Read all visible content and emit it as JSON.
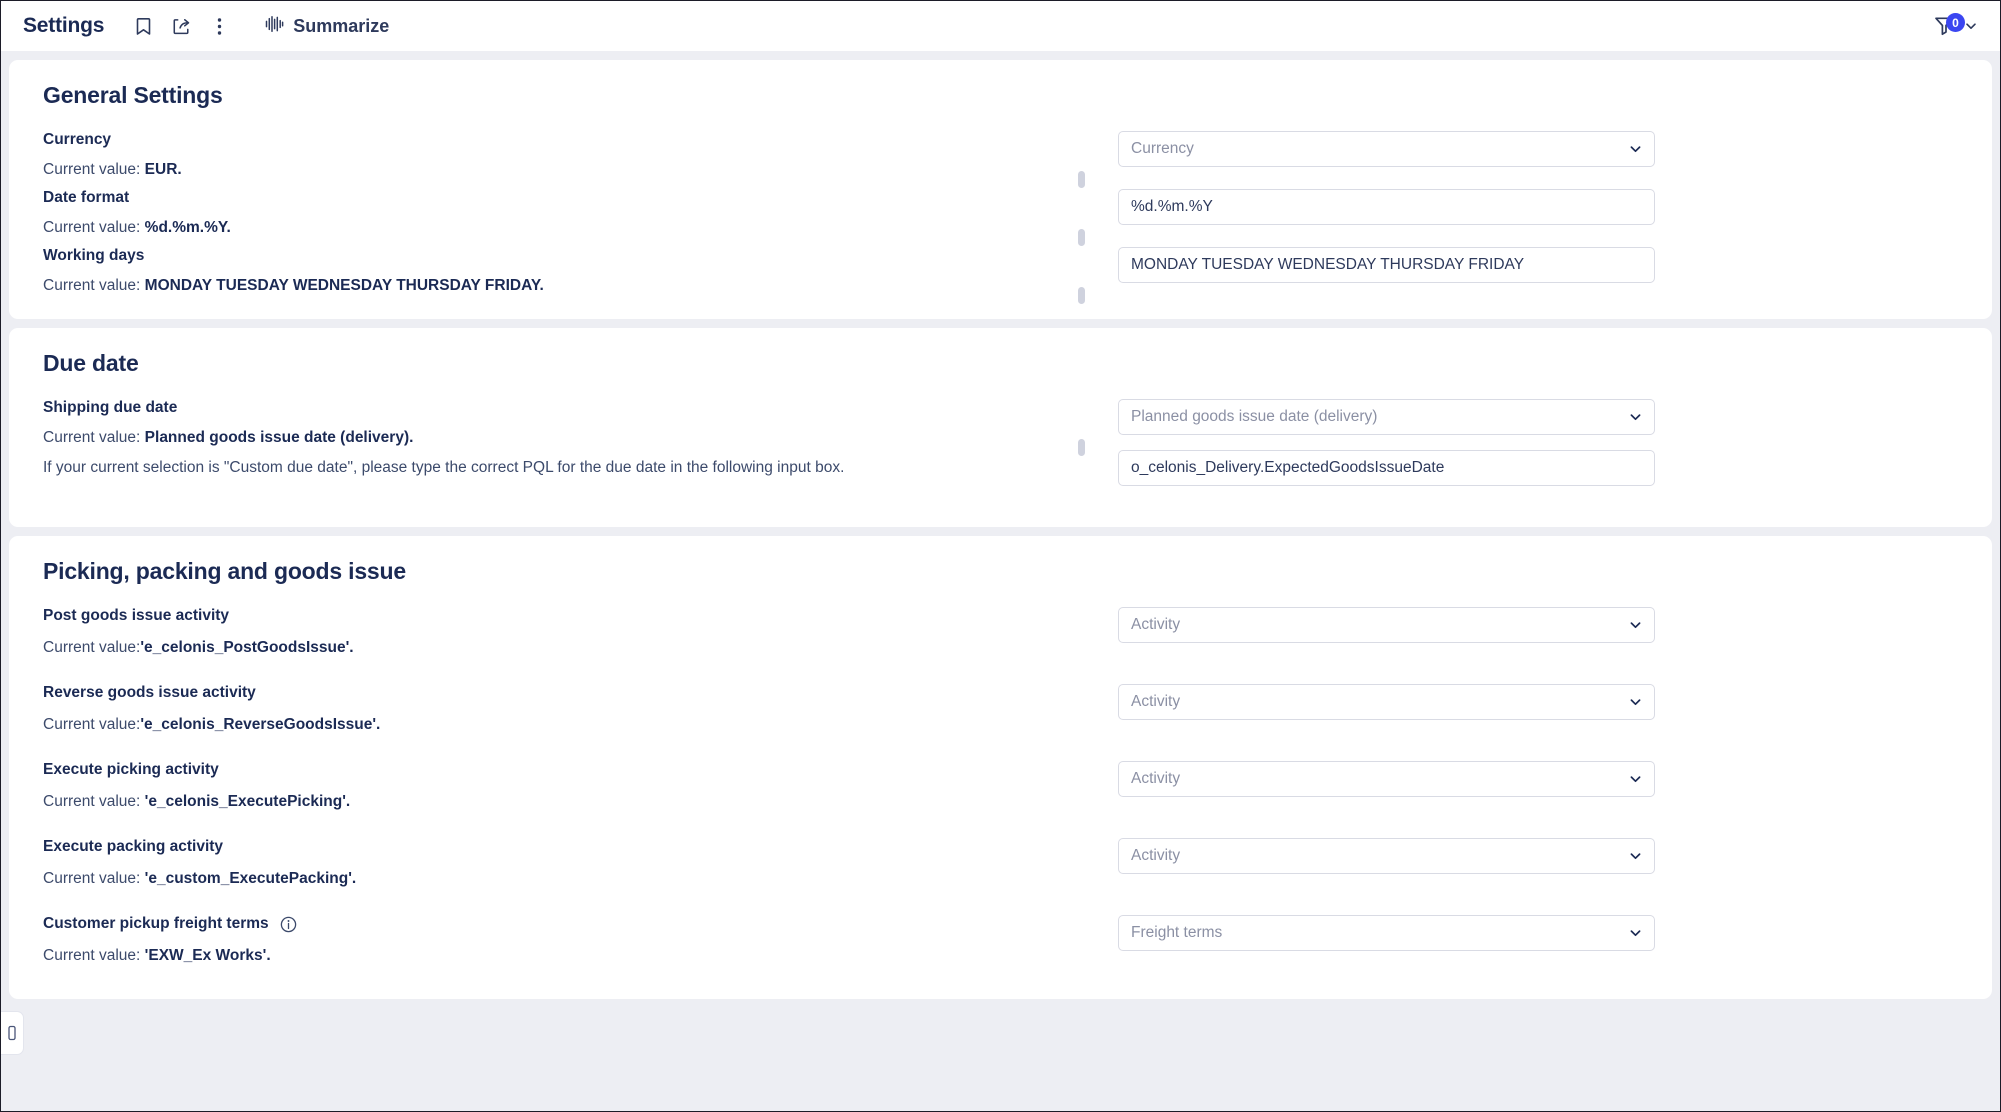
{
  "header": {
    "title": "Settings",
    "icons": [
      {
        "name": "bookmark-icon",
        "label": "Bookmark"
      },
      {
        "name": "share-icon",
        "label": "Share"
      },
      {
        "name": "more-vertical-icon",
        "label": "More options"
      }
    ],
    "summarize": {
      "label": "Summarize",
      "icon": "waveform-icon"
    },
    "filter": {
      "count": "0",
      "icon": "filter-icon",
      "chevron": "chevron-down-icon"
    },
    "accent_color": "#3b46f1",
    "title_color": "#1b2a54"
  },
  "sections": [
    {
      "title": "General Settings",
      "rows": [
        {
          "label": "Currency",
          "value_prefix": "Current value: ",
          "value": "EUR.",
          "control": {
            "type": "select",
            "placeholder": "Currency"
          }
        },
        {
          "label": "Date format",
          "value_prefix": "Current value: ",
          "value": "%d.%m.%Y.",
          "control": {
            "type": "text",
            "value": "%d.%m.%Y"
          }
        },
        {
          "label": "Working days",
          "value_prefix": "Current value: ",
          "value": "MONDAY TUESDAY WEDNESDAY THURSDAY FRIDAY.",
          "control": {
            "type": "text",
            "value": "MONDAY TUESDAY WEDNESDAY THURSDAY FRIDAY"
          }
        }
      ]
    },
    {
      "title": "Due date",
      "rows": [
        {
          "label": "Shipping due date",
          "value_prefix": "Current value: ",
          "value": "Planned goods issue date (delivery).",
          "control": {
            "type": "select",
            "placeholder": "Planned goods issue date (delivery)"
          }
        },
        {
          "helper": "If your current selection is \"Custom due date\", please type the correct PQL for the due date in the following input box.",
          "control": {
            "type": "text",
            "value": "o_celonis_Delivery.ExpectedGoodsIssueDate"
          }
        }
      ]
    },
    {
      "title": "Picking, packing and goods issue",
      "rows": [
        {
          "label": "Post goods issue activity",
          "value_prefix": "Current value:",
          "value": "'e_celonis_PostGoodsIssue'.",
          "control": {
            "type": "select",
            "placeholder": "Activity"
          }
        },
        {
          "label": "Reverse goods issue activity",
          "value_prefix": "Current value:",
          "value": "'e_celonis_ReverseGoodsIssue'.",
          "control": {
            "type": "select",
            "placeholder": "Activity"
          }
        },
        {
          "label": "Execute picking activity",
          "value_prefix": "Current value: ",
          "value": "'e_celonis_ExecutePicking'.",
          "control": {
            "type": "select",
            "placeholder": "Activity"
          }
        },
        {
          "label": "Execute packing activity",
          "value_prefix": "Current value: ",
          "value": "'e_custom_ExecutePacking'.",
          "control": {
            "type": "select",
            "placeholder": "Activity"
          }
        },
        {
          "label": "Customer pickup freight terms",
          "has_info_icon": true,
          "value_prefix": "Current value: ",
          "value": "'EXW_Ex Works'.",
          "control": {
            "type": "select",
            "placeholder": "Freight terms"
          }
        }
      ]
    }
  ]
}
